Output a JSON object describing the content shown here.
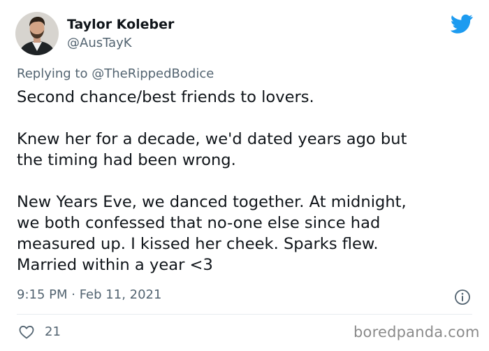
{
  "tweet": {
    "author": {
      "display_name": "Taylor Koleber",
      "handle": "@AusTayK",
      "avatar_icon": "user-avatar"
    },
    "platform_icon": "twitter-bird-icon",
    "brand_color": "#1d9bf0",
    "reply": {
      "prefix": "Replying to",
      "to_handle": "@TheRippedBodice"
    },
    "body_lines": [
      "Second chance/best friends to lovers.",
      "",
      "Knew her for a decade, we'd dated years ago but",
      "the timing had been wrong.",
      "",
      "New Years Eve, we danced together. At midnight,",
      "we both confessed that no-one else since had",
      "measured up. I kissed her cheek. Sparks flew.",
      "Married within a year <3"
    ],
    "timestamp": "9:15 PM · Feb 11, 2021",
    "info_icon": "info-icon",
    "likes": {
      "icon": "heart-icon",
      "count": "21"
    }
  },
  "watermark": "boredpanda.com"
}
